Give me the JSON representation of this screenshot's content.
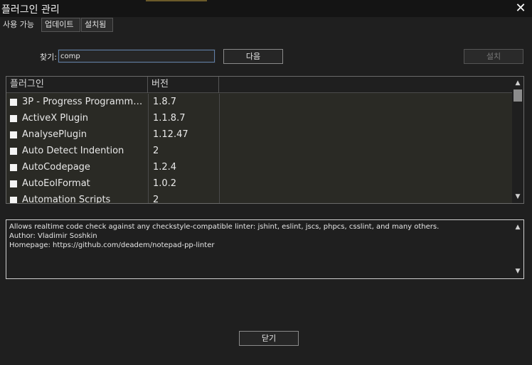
{
  "window": {
    "title": "플러그인 관리",
    "close_glyph": "✕"
  },
  "tabs": [
    {
      "label": "사용 가능"
    },
    {
      "label": "업데이트"
    },
    {
      "label": "설치됨"
    }
  ],
  "search": {
    "label": "찾기:",
    "value": "comp"
  },
  "buttons": {
    "next": "다음",
    "install": "설치",
    "close": "닫기"
  },
  "list": {
    "columns": [
      "플러그인",
      "버전"
    ],
    "rows": [
      {
        "name": "3P - Progress Programme...",
        "version": "1.8.7"
      },
      {
        "name": "ActiveX Plugin",
        "version": "1.1.8.7"
      },
      {
        "name": "AnalysePlugin",
        "version": "1.12.47"
      },
      {
        "name": "Auto Detect Indention",
        "version": "2"
      },
      {
        "name": "AutoCodepage",
        "version": "1.2.4"
      },
      {
        "name": "AutoEolFormat",
        "version": "1.0.2"
      },
      {
        "name": "Automation Scripts",
        "version": "2"
      }
    ]
  },
  "description": {
    "text": "Allows realtime code check against any checkstyle-compatible linter: jshint, eslint, jscs, phpcs, csslint, and many others.\nAuthor: Vladimir Soshkin\nHomepage: https://github.com/deadem/notepad-pp-linter"
  },
  "icons": {
    "scroll_up": "▲",
    "scroll_down": "▼"
  }
}
